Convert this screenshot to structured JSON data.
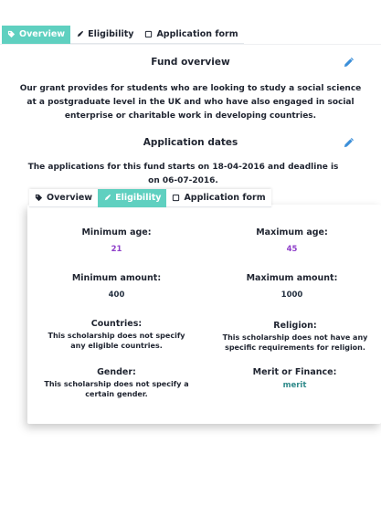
{
  "top_tabs": [
    {
      "label": "Overview",
      "icon": "tag-icon",
      "active": true
    },
    {
      "label": "Eligibility",
      "icon": "pen-icon",
      "active": false
    },
    {
      "label": "Application form",
      "icon": "form-icon",
      "active": false
    }
  ],
  "fund_overview": {
    "title": "Fund overview",
    "text": "Our grant provides for students who are looking to study a social science at a postgraduate level in the UK and who have also engaged in social enterprise or charitable work in developing countries."
  },
  "application_dates": {
    "title": "Application dates",
    "text": "The applications for this fund starts on 18-04-2016 and deadline is on 06-07-2016."
  },
  "card_tabs": [
    {
      "label": "Overview",
      "icon": "tag-icon",
      "active": false
    },
    {
      "label": "Eligibility",
      "icon": "pen-icon",
      "active": true
    },
    {
      "label": "Application form",
      "icon": "form-icon",
      "active": false
    }
  ],
  "eligibility": {
    "min_age": {
      "label": "Minimum age:",
      "value": "21"
    },
    "max_age": {
      "label": "Maximum age:",
      "value": "45"
    },
    "min_amount": {
      "label": "Minimum amount:",
      "value": "400"
    },
    "max_amount": {
      "label": "Maximum amount:",
      "value": "1000"
    },
    "countries": {
      "label": "Countries:",
      "text": "This scholarship does not specify any eligible countries."
    },
    "religion": {
      "label": "Religion:",
      "text": "This scholarship does not have any specific requirements for religion."
    },
    "gender": {
      "label": "Gender:",
      "text": "This scholarship does not specify a certain gender."
    },
    "merit": {
      "label": "Merit or Finance:",
      "value": "merit"
    }
  },
  "colors": {
    "accent": "#5fd0c0",
    "edit_icon": "#3b8fd9",
    "purple_value": "#8e3fc9",
    "teal_value": "#2f8a8a"
  }
}
